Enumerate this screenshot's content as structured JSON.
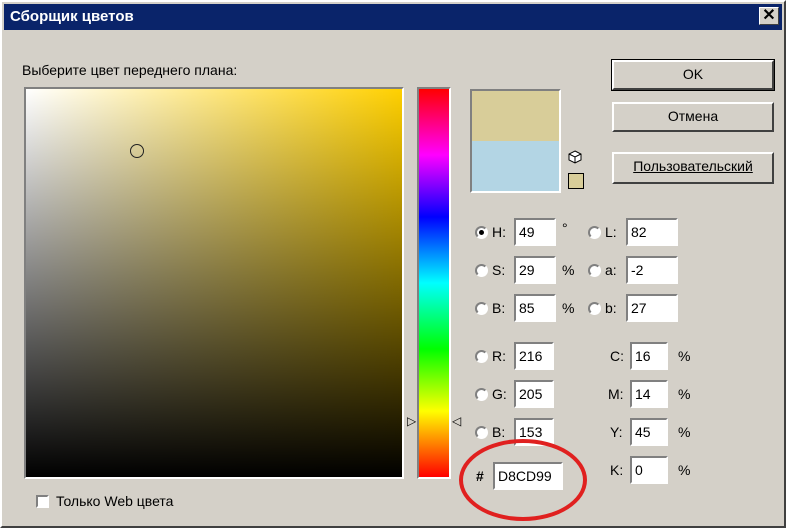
{
  "window": {
    "title": "Сборщик цветов",
    "close_glyph": "✕"
  },
  "prompt_label": "Выберите цвет переднего плана:",
  "buttons": {
    "ok": "OK",
    "cancel": "Отмена",
    "custom": "Пользовательский"
  },
  "swatches": {
    "new_color": "#d8cd99",
    "current_color": "#b3d5e4"
  },
  "hsb": {
    "h": {
      "label": "H:",
      "value": "49",
      "unit": "°",
      "selected": true
    },
    "s": {
      "label": "S:",
      "value": "29",
      "unit": "%"
    },
    "b": {
      "label": "B:",
      "value": "85",
      "unit": "%"
    }
  },
  "lab": {
    "l": {
      "label": "L:",
      "value": "82"
    },
    "a": {
      "label": "a:",
      "value": "-2"
    },
    "b": {
      "label": "b:",
      "value": "27"
    }
  },
  "rgb": {
    "r": {
      "label": "R:",
      "value": "216"
    },
    "g": {
      "label": "G:",
      "value": "205"
    },
    "b": {
      "label": "B:",
      "value": "153"
    }
  },
  "cmyk": {
    "c": {
      "label": "C:",
      "value": "16",
      "unit": "%"
    },
    "m": {
      "label": "M:",
      "value": "14",
      "unit": "%"
    },
    "y": {
      "label": "Y:",
      "value": "45",
      "unit": "%"
    },
    "k": {
      "label": "K:",
      "value": "0",
      "unit": "%"
    }
  },
  "hex": {
    "label": "#",
    "value": "D8CD99"
  },
  "web_only": {
    "label": "Только Web цвета",
    "checked": false
  },
  "icons": {
    "close": "close-icon",
    "gamut_warning": "cube-icon",
    "web_swatch": "web-safe-swatch"
  },
  "highlight_color": "#e0201f"
}
